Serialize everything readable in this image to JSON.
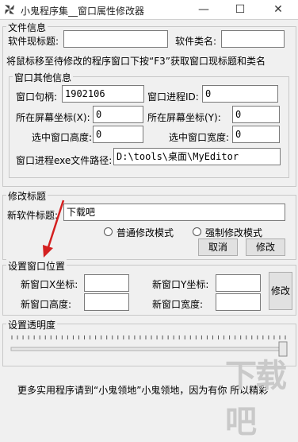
{
  "window": {
    "title": "小鬼程序集__窗口属性修改器",
    "minimize": "—",
    "maximize": "☐",
    "close": "✕",
    "icon": "pinwheel-icon"
  },
  "file_info": {
    "group_label": "文件信息",
    "title_label": "软件现标题:",
    "title_value": "",
    "class_label": "软件类名:",
    "class_value": "",
    "hint": "将鼠标移至待修改的程序窗口下按“F3”获取窗口现标题和类名",
    "other_info": {
      "group_label": "窗口其他信息",
      "handle_label": "窗口句柄:",
      "handle_value": "1902106",
      "pid_label": "窗口进程ID:",
      "pid_value": "0",
      "screen_x_label": "所在屏幕坐标(X):",
      "screen_x_value": "0",
      "screen_y_label": "所在屏幕坐标(Y):",
      "screen_y_value": "0",
      "height_label": "选中窗口高度:",
      "height_value": "0",
      "width_label": "选中窗口宽度:",
      "width_value": "0",
      "path_label": "窗口进程exe文件路径:",
      "path_value": "D:\\tools\\桌面\\MyEditor"
    }
  },
  "modify_title": {
    "group_label": "修改标题",
    "new_title_label": "新软件标题:",
    "new_title_value": "下载吧",
    "mode_normal": "普通修改模式",
    "mode_force": "强制修改模式",
    "cancel_button": "取消",
    "modify_button": "修改"
  },
  "window_position": {
    "group_label": "设置窗口位置",
    "new_x_label": "新窗口X坐标:",
    "new_x_value": "",
    "new_y_label": "新窗口Y坐标:",
    "new_y_value": "",
    "new_height_label": "新窗口高度:",
    "new_height_value": "",
    "new_width_label": "新窗口宽度:",
    "new_width_value": "",
    "modify_button": "修改"
  },
  "transparency": {
    "group_label": "设置透明度",
    "level_fraction": 1.0
  },
  "footer": {
    "text": "更多实用程序请到“小鬼领地”小鬼领地，因为有你 所以精彩"
  },
  "watermark": {
    "text": "下载吧"
  },
  "colors": {
    "arrow": "#d42020",
    "watermark": "#c9c9c9"
  }
}
